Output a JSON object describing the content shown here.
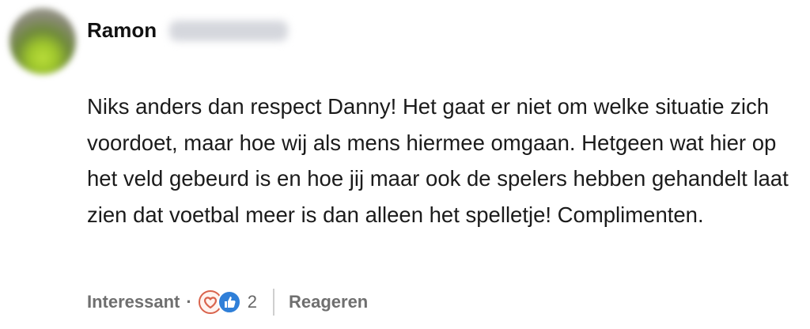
{
  "comment": {
    "author": {
      "name": "Ramon",
      "surname_blurred": true
    },
    "text": "Niks anders dan respect Danny! Het gaat er niet om welke situatie zich voordoet, maar hoe wij als mens hiermee omgaan. Hetgeen wat hier op het veld gebeurd is en hoe jij maar ook de spelers hebben gehandelt laat zien dat voetbal meer is dan alleen het spelletje! Complimenten.",
    "actions": {
      "react_label": "Interessant",
      "separator": "·",
      "reaction_icons": [
        "heart-reaction-icon",
        "thumbs-up-reaction-icon"
      ],
      "reaction_count": "2",
      "reply_label": "Reageren"
    }
  },
  "colors": {
    "heart_badge": "#d9634c",
    "like_badge": "#2f7fd8",
    "secondary_text": "#6f6f6f"
  }
}
